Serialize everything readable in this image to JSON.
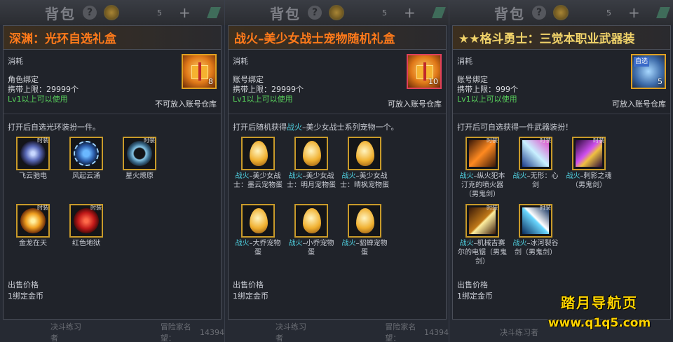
{
  "backdrop": {
    "title": "背包",
    "help": "?",
    "count": "5",
    "plus": "+",
    "extra": "1"
  },
  "footer": {
    "left": "决斗练习者",
    "right": "冒险家名望：",
    "fame": "14394"
  },
  "panels": [
    {
      "title": "深渊：光环自选礼盒",
      "title_color": "#ff7a1a",
      "category": "消耗",
      "bind": "角色绑定",
      "carry": "携带上限：29999个",
      "level": "Lv1以上可以使用",
      "storage": "不可放入账号仓库",
      "count": "8",
      "desc": "打开后自选光环装扮一件。",
      "items": [
        {
          "icon": "halo-icon",
          "label": "飞云驰电",
          "lim": "时装"
        },
        {
          "icon": "halo-icon",
          "label": "风起云涌",
          "lim": ""
        },
        {
          "icon": "halo-icon",
          "label": "星火燎原",
          "lim": "时装"
        },
        {
          "icon": "halo-icon",
          "label": "金龙在天",
          "lim": "时装"
        },
        {
          "icon": "halo-icon",
          "label": "红色地狱",
          "lim": "时装"
        }
      ],
      "price_label": "出售价格",
      "price": "1绑定金币"
    },
    {
      "title": "战火–美少女战士宠物随机礼盒",
      "title_color": "#ff7a1a",
      "category": "消耗",
      "bind": "账号绑定",
      "carry": "携带上限：29999个",
      "level": "Lv1以上可以使用",
      "storage": "可放入账号仓库",
      "count": "10",
      "desc_a": "打开后随机获得",
      "desc_hl": "战火",
      "desc_b": "–美少女战士系列宠物一个。",
      "items": [
        {
          "icon": "pet-egg-icon",
          "hl": "战火",
          "label": "–美少女战士：墨云宠物蛋"
        },
        {
          "icon": "pet-egg-icon",
          "hl": "战火",
          "label": "–美少女战士：明月宠物蛋"
        },
        {
          "icon": "pet-egg-icon",
          "hl": "战火",
          "label": "–美少女战士：晴枫宠物蛋"
        },
        {
          "icon": "pet-egg-icon",
          "hl": "战火",
          "label": "–大乔宠物蛋"
        },
        {
          "icon": "pet-egg-icon",
          "hl": "战火",
          "label": "–小乔宠物蛋"
        },
        {
          "icon": "pet-egg-icon",
          "hl": "战火",
          "label": "–貂蝉宠物蛋"
        }
      ],
      "price_label": "出售价格",
      "price": "1绑定金币"
    },
    {
      "title": "★★格斗勇士：三觉本职业武器装",
      "title_color": "#f1d36a",
      "category": "消耗",
      "bind": "账号绑定",
      "carry": "携带上限：999个",
      "level": "Lv1以上可以使用",
      "storage": "可放入账号仓库",
      "count": "5",
      "tag": "自选",
      "desc": "打开后可自选获得一件武器装扮！",
      "items": [
        {
          "icon": "weapon-icon",
          "hl": "战火",
          "label": "–纵火犯本汀克的喷火器（男鬼剑）",
          "lim": "时装"
        },
        {
          "icon": "weapon-icon",
          "hl": "战火",
          "label": "–无形：心剑",
          "lim": "时装"
        },
        {
          "icon": "weapon-icon",
          "hl": "战火",
          "label": "–刺影之魂（男鬼剑）",
          "lim": "时装"
        },
        {
          "icon": "weapon-icon",
          "hl": "战火",
          "label": "–机械吉赛尔的电锯（男鬼剑）",
          "lim": "时装"
        },
        {
          "icon": "weapon-icon",
          "hl": "战火",
          "label": "–冰河裂谷剑（男鬼剑）",
          "lim": "时装"
        }
      ],
      "price_label": "出售价格",
      "price": "1绑定金币"
    }
  ],
  "watermark": {
    "line1": "踏月导航页",
    "line2": "www.q1q5.com"
  }
}
